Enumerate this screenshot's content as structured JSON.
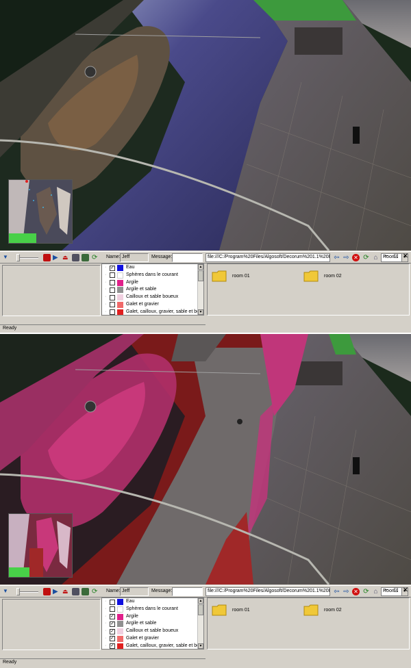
{
  "panels": [
    {
      "mode": "normal",
      "toolbar": {
        "name_label": "Name:",
        "name_value": "Jeff",
        "message_label": "Message:",
        "message_value": "",
        "address": "file:///C:/Program%20Files/Algosoft/Decorum%201.1%20En",
        "view_select": "Rooms"
      },
      "legend": [
        {
          "label": "Eau",
          "color": "#1010e0",
          "checked": true
        },
        {
          "label": "Sphères dans le courant",
          "color": "#ffffff",
          "checked": false
        },
        {
          "label": "Argile",
          "color": "#e0208a",
          "checked": false
        },
        {
          "label": "Argile et sable",
          "color": "#909090",
          "checked": false
        },
        {
          "label": "Cailloux et sable boueux",
          "color": "#f0d0e0",
          "checked": false
        },
        {
          "label": "Galet et gravier",
          "color": "#f06a6a",
          "checked": false
        },
        {
          "label": "Galet, cailloux, gravier, sable et bou",
          "color": "#e02020",
          "checked": false
        }
      ],
      "files": [
        {
          "label": "room 01"
        },
        {
          "label": "room 02"
        }
      ],
      "status": "Ready"
    },
    {
      "mode": "overlay",
      "toolbar": {
        "name_label": "Name:",
        "name_value": "Jeff",
        "message_label": "Message:",
        "message_value": "",
        "address": "file:///C:/Program%20Files/Algosoft/Decorum%201.1%20En",
        "view_select": "Rooms"
      },
      "legend": [
        {
          "label": "Eau",
          "color": "#1010e0",
          "checked": false
        },
        {
          "label": "Sphères dans le courant",
          "color": "#ffffff",
          "checked": false
        },
        {
          "label": "Argile",
          "color": "#e0208a",
          "checked": true
        },
        {
          "label": "Argile et sable",
          "color": "#909090",
          "checked": true
        },
        {
          "label": "Cailloux et sable boueux",
          "color": "#f0d0e0",
          "checked": true
        },
        {
          "label": "Galet et gravier",
          "color": "#f06a6a",
          "checked": true
        },
        {
          "label": "Galet, cailloux, gravier, sable et bou",
          "color": "#e02020",
          "checked": true
        }
      ],
      "files": [
        {
          "label": "room 01"
        },
        {
          "label": "room 02"
        }
      ],
      "status": "Ready"
    }
  ],
  "icons": {
    "record": "record-icon",
    "play": "play-icon",
    "eject": "eject-icon",
    "camera": "camera-icon",
    "tools": "tools-icon",
    "refresh": "refresh-icon",
    "back": "back-arrow-icon",
    "forward": "forward-arrow-icon",
    "stop": "stop-icon",
    "folder": "folder-icon"
  }
}
